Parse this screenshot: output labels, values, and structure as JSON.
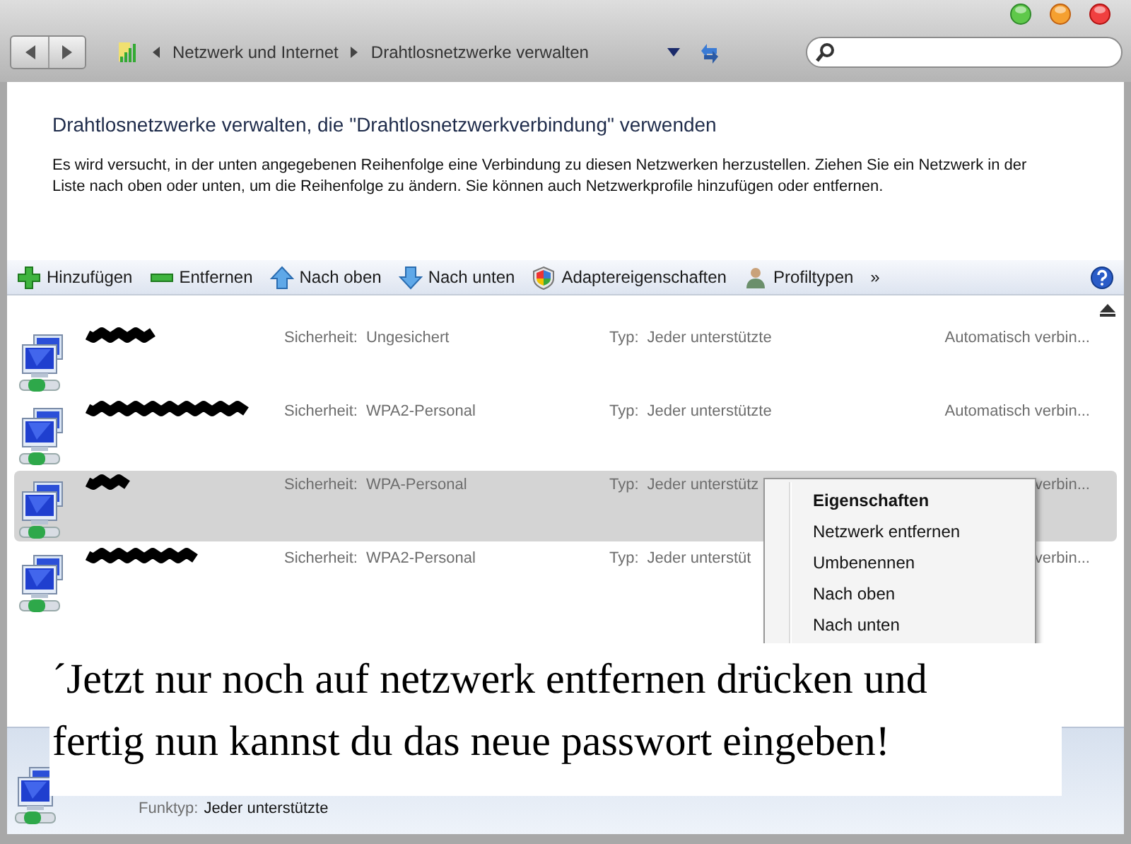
{
  "address": {
    "crumbs": [
      "Netzwerk und Internet",
      "Drahtlosnetzwerke verwalten"
    ]
  },
  "heading": "Drahtlosnetzwerke verwalten, die \"Drahtlosnetzwerkverbindung\" verwenden",
  "description": "Es wird versucht, in der unten angegebenen Reihenfolge eine Verbindung zu diesen Netzwerken herzustellen. Ziehen Sie ein Netzwerk in der Liste nach oben oder unten, um die Reihenfolge zu ändern. Sie können auch Netzwerkprofile hinzufügen oder entfernen.",
  "toolbar": [
    {
      "kind": "add",
      "label": "Hinzufügen"
    },
    {
      "kind": "remove",
      "label": "Entfernen"
    },
    {
      "kind": "up",
      "label": "Nach oben"
    },
    {
      "kind": "down",
      "label": "Nach unten"
    },
    {
      "kind": "shield",
      "label": "Adaptereigenschaften"
    },
    {
      "kind": "user",
      "label": "Profiltypen"
    },
    {
      "kind": "more",
      "label": "»"
    }
  ],
  "networks": [
    {
      "selected": false,
      "security_label": "Sicherheit:",
      "security": "Ungesichert",
      "type_label": "Typ:",
      "type": "Jeder unterstützte",
      "connection": "Automatisch verbin..."
    },
    {
      "selected": false,
      "security_label": "Sicherheit:",
      "security": "WPA2-Personal",
      "type_label": "Typ:",
      "type": "Jeder unterstützte",
      "connection": "Automatisch verbin..."
    },
    {
      "selected": true,
      "security_label": "Sicherheit:",
      "security": "WPA-Personal",
      "type_label": "Typ:",
      "type": "Jeder unterstütz",
      "connection": "verbin..."
    },
    {
      "selected": false,
      "security_label": "Sicherheit:",
      "security": "WPA2-Personal",
      "type_label": "Typ:",
      "type": "Jeder unterstüt",
      "connection": "verbin..."
    }
  ],
  "context_menu": [
    {
      "label": "Eigenschaften",
      "default": true
    },
    {
      "label": "Netzwerk entfernen",
      "default": false
    },
    {
      "label": "Umbenennen",
      "default": false
    },
    {
      "label": "Nach oben",
      "default": false
    },
    {
      "label": "Nach unten",
      "default": false
    }
  ],
  "details": {
    "label": "Funktyp:",
    "value": "Jeder unterstützte"
  },
  "annotation": [
    "´Jetzt nur noch auf netzwerk entfernen drücken und",
    "fertig nun kannst du das neue passwort eingeben!"
  ]
}
